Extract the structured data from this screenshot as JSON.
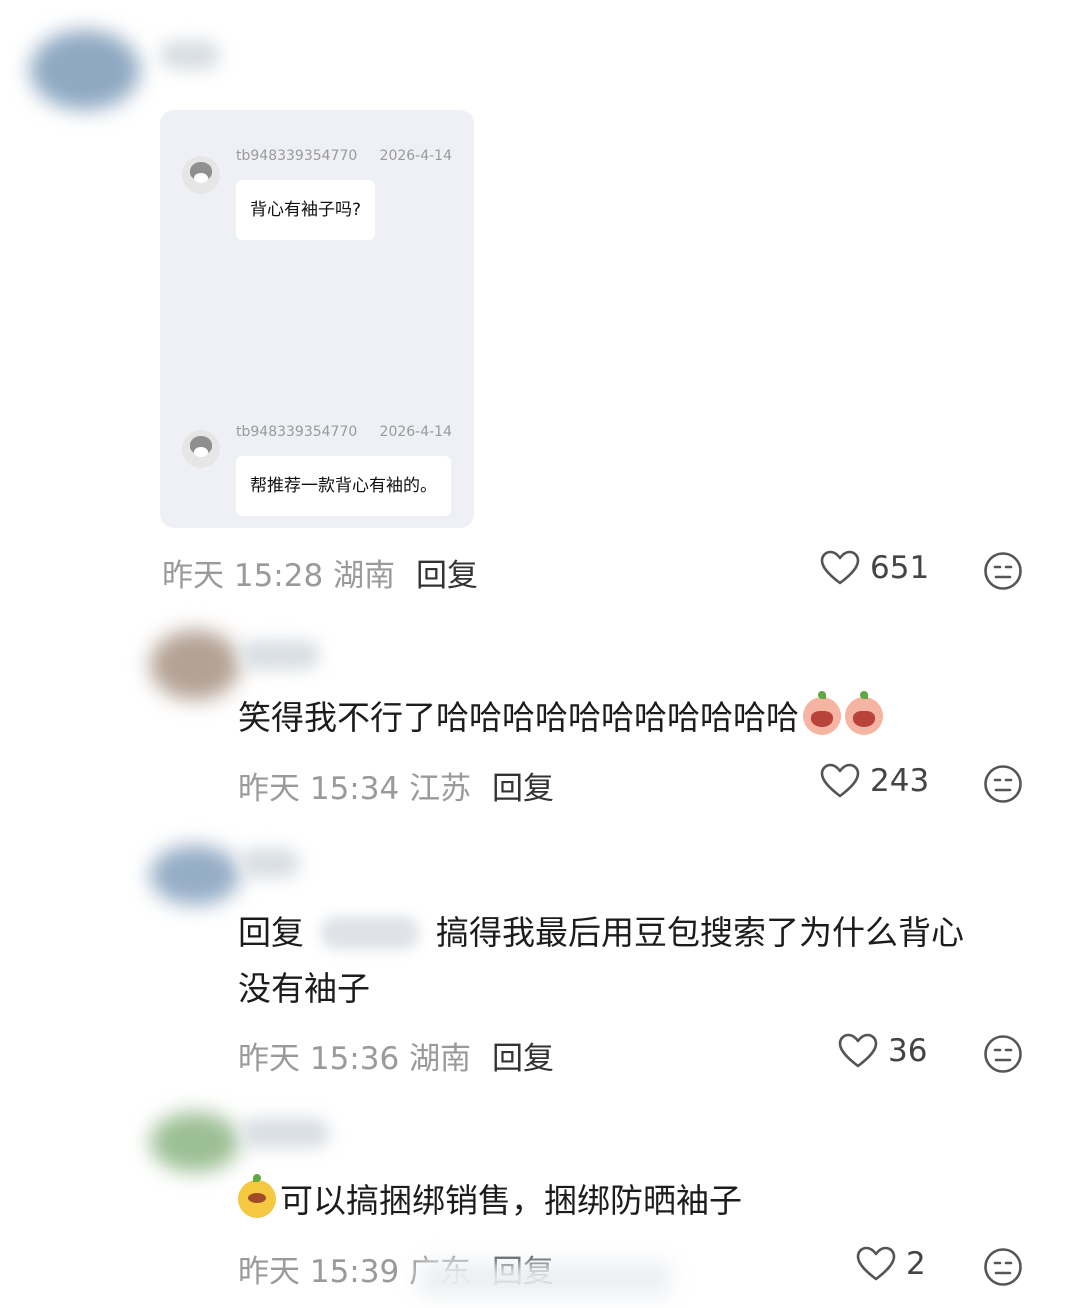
{
  "screenshot": {
    "messages": [
      {
        "username": "tb948339354770",
        "date": "2026-4-14",
        "text": "背心有袖子吗?"
      },
      {
        "username": "tb948339354770",
        "date": "2026-4-14",
        "text": "帮推荐一款背心有袖的。"
      }
    ]
  },
  "comments": [
    {
      "time": "昨天 15:28",
      "location": "湖南",
      "reply_label": "回复",
      "likes": "651"
    },
    {
      "text": "笑得我不行了哈哈哈哈哈哈哈哈哈哈哈",
      "time": "昨天 15:34",
      "location": "江苏",
      "reply_label": "回复",
      "likes": "243"
    },
    {
      "reply_prefix": "回复",
      "text_line1": "搞得我最后用豆包搜索了为什么背心",
      "text_line2": "没有袖子",
      "time": "昨天 15:36",
      "location": "湖南",
      "reply_label": "回复",
      "likes": "36"
    },
    {
      "text": "可以搞捆绑销售，捆绑防晒袖子",
      "time": "昨天 15:39",
      "location": "广东",
      "reply_label": "回复",
      "likes": "2"
    }
  ],
  "icons": {
    "like": "heart-outline-icon",
    "dislike": "neutral-face-icon",
    "emoji_cry": "crying-face-emoji",
    "emoji_peach": "peach-face-emoji"
  },
  "colors": {
    "meta_text": "#9a9a9a",
    "screenshot_bg": "#eef0f5"
  }
}
